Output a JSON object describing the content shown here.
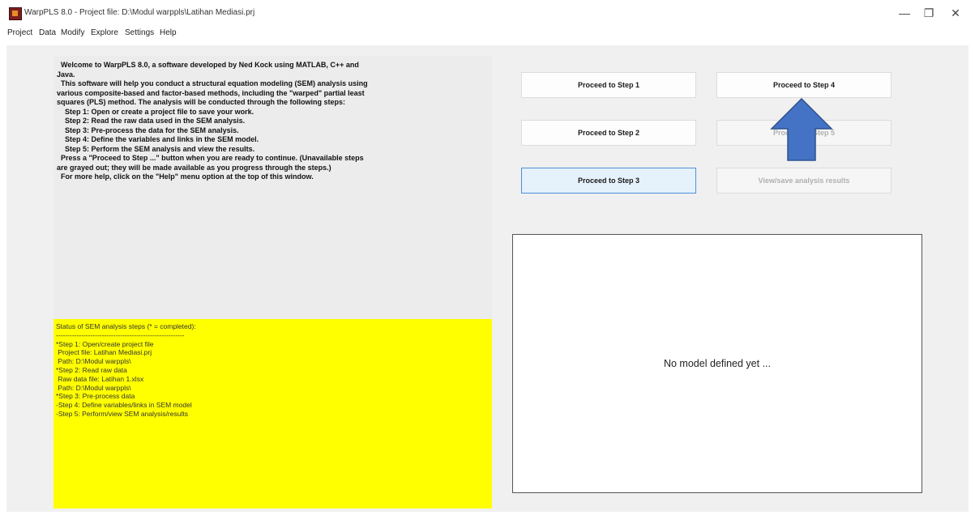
{
  "window": {
    "title": "WarpPLS 8.0 - Project file: D:\\Modul warppls\\Latihan Mediasi.prj",
    "minimize_label": "—",
    "maximize_label": "❐",
    "close_label": "✕"
  },
  "menu": [
    "Project",
    "Data",
    "Modify",
    "Explore",
    "Settings",
    "Help"
  ],
  "welcome_lines": [
    "  Welcome to WarpPLS 8.0, a software developed by Ned Kock using MATLAB, C++ and",
    "Java.",
    "",
    "  This software will help you conduct a structural equation modeling (SEM) analysis using",
    "various composite-based and factor-based methods, including the \"warped\" partial least",
    "squares (PLS) method. The analysis will be conducted through the following steps:",
    "    Step 1: Open or create a project file to save your work.",
    "    Step 2: Read the raw data used in the SEM analysis.",
    "    Step 3: Pre-process the data for the SEM analysis.",
    "    Step 4: Define the variables and links in the SEM model.",
    "    Step 5: Perform the SEM analysis and view the results.",
    "",
    "  Press a \"Proceed to Step ...\" button when you are ready to continue. (Unavailable steps",
    "are grayed out; they will be made available as you progress through the steps.)",
    "  For more help, click on the \"Help\" menu option at the top of this window."
  ],
  "status_lines": [
    "Status of SEM analysis steps (* = completed):",
    "--------------------------------------------------------",
    "",
    "*Step 1: Open/create project file",
    " Project file: Latihan Mediasi.prj",
    " Path: D:\\Modul warppls\\",
    "*Step 2: Read raw data",
    " Raw data file: Latihan 1.xlsx",
    " Path: D:\\Modul warppls\\",
    "*Step 3: Pre-process data",
    "-Step 4: Define variables/links in SEM model",
    "-Step 5: Perform/view SEM analysis/results"
  ],
  "buttons": {
    "step1": "Proceed to Step 1",
    "step2": "Proceed to Step 2",
    "step3": "Proceed to Step 3",
    "step4": "Proceed to Step 4",
    "step5": "Proceed to Step 5",
    "view_results": "View/save analysis results"
  },
  "model_view": {
    "message": "No model defined yet ..."
  },
  "colors": {
    "status_bg": "#ffff00",
    "arrow": "#4472c4"
  }
}
